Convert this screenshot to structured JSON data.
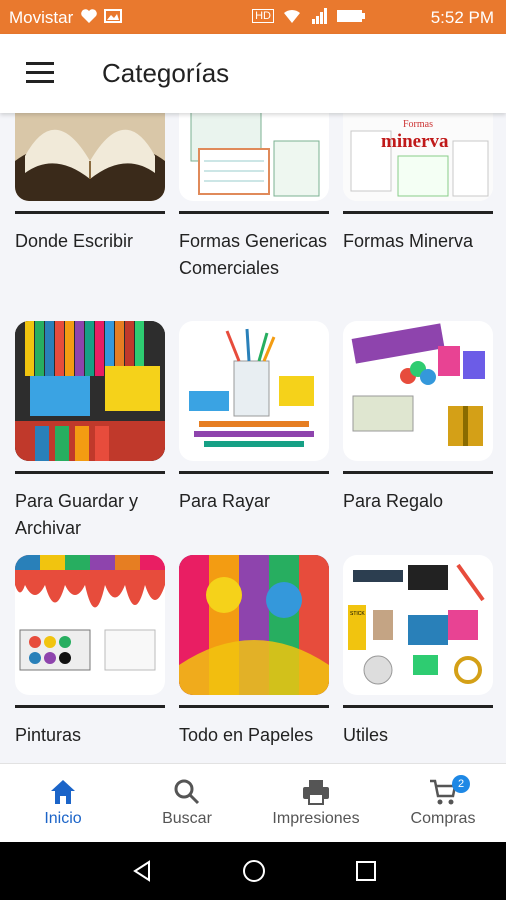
{
  "status_bar": {
    "carrier": "Movistar",
    "time": "5:52 PM",
    "signal_label": "HD"
  },
  "header": {
    "title": "Categorías"
  },
  "categories": [
    {
      "label": "Donde Escribir"
    },
    {
      "label": "Formas Genericas Comerciales"
    },
    {
      "label": "Formas Minerva"
    },
    {
      "label": "Para Guardar y Archivar"
    },
    {
      "label": "Para Rayar"
    },
    {
      "label": "Para Regalo"
    },
    {
      "label": "Pinturas"
    },
    {
      "label": "Todo en Papeles"
    },
    {
      "label": "Utiles"
    }
  ],
  "image_text": {
    "minerva": "minerva",
    "formas": "Formas",
    "stick": "STICK"
  },
  "bottom_nav": {
    "items": [
      {
        "label": "Inicio",
        "icon": "home-icon",
        "active": true
      },
      {
        "label": "Buscar",
        "icon": "search-icon"
      },
      {
        "label": "Impresiones",
        "icon": "printer-icon"
      },
      {
        "label": "Compras",
        "icon": "cart-icon"
      }
    ],
    "cart_badge": "2"
  },
  "colors": {
    "status_bar": "#e9792e",
    "accent": "#1b64c8",
    "badge": "#1e88e5"
  }
}
